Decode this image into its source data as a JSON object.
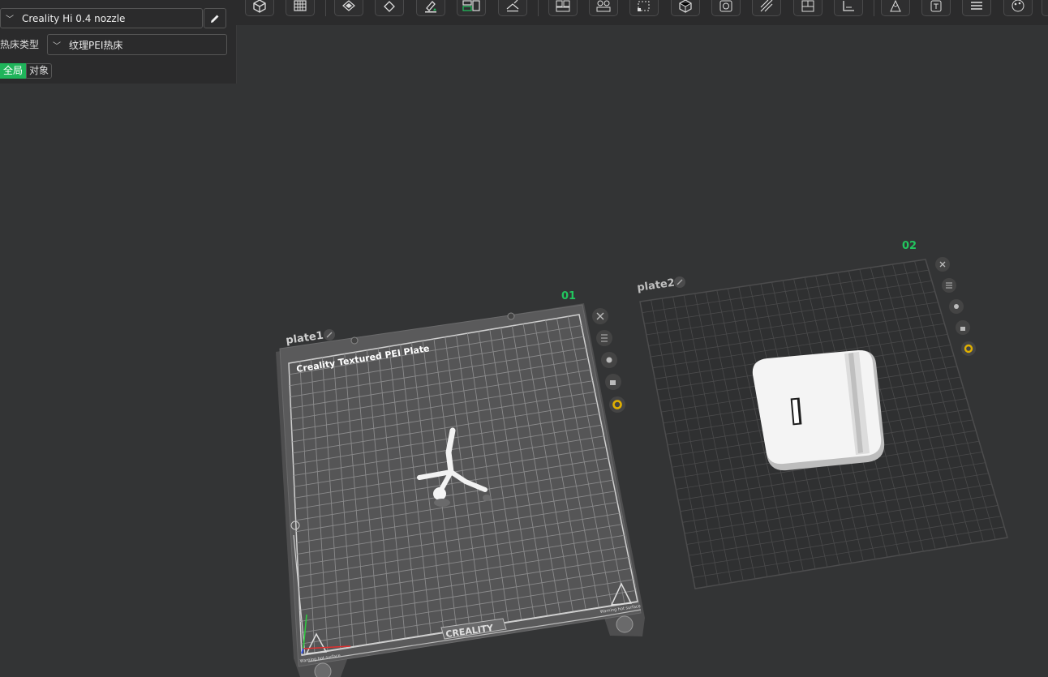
{
  "left_panel": {
    "printer": "Creality Hi 0.4 nozzle",
    "bed_type_label": "热床类型",
    "bed_type_value": "纹理PEI热床",
    "scope_tabs": [
      "全局",
      "对象"
    ]
  },
  "toolbar": {
    "icons": [
      "add-cube-icon",
      "grid-icon",
      "auto-orient-icon",
      "lay-on-face-icon",
      "paint-icon",
      "arrange-icon",
      "slice-plane-icon",
      "split-objects-icon",
      "split-parts-icon",
      "scale-icon",
      "cube-view-icon",
      "hollow-icon",
      "support-paint-icon",
      "cut-icon",
      "measure-icon",
      "seam-icon",
      "text-icon",
      "layers-icon",
      "color-paint-icon"
    ]
  },
  "viewport": {
    "plate1": {
      "name": "plate1",
      "number": "01",
      "bed_title": "Creality Textured PEI Plate",
      "brand": "CREALITY",
      "warning": "Warning hot surface"
    },
    "plate2": {
      "name": "plate2",
      "number": "02"
    },
    "plate_number_color": "#22c55e",
    "settings_icon_color": "#e0b000"
  }
}
